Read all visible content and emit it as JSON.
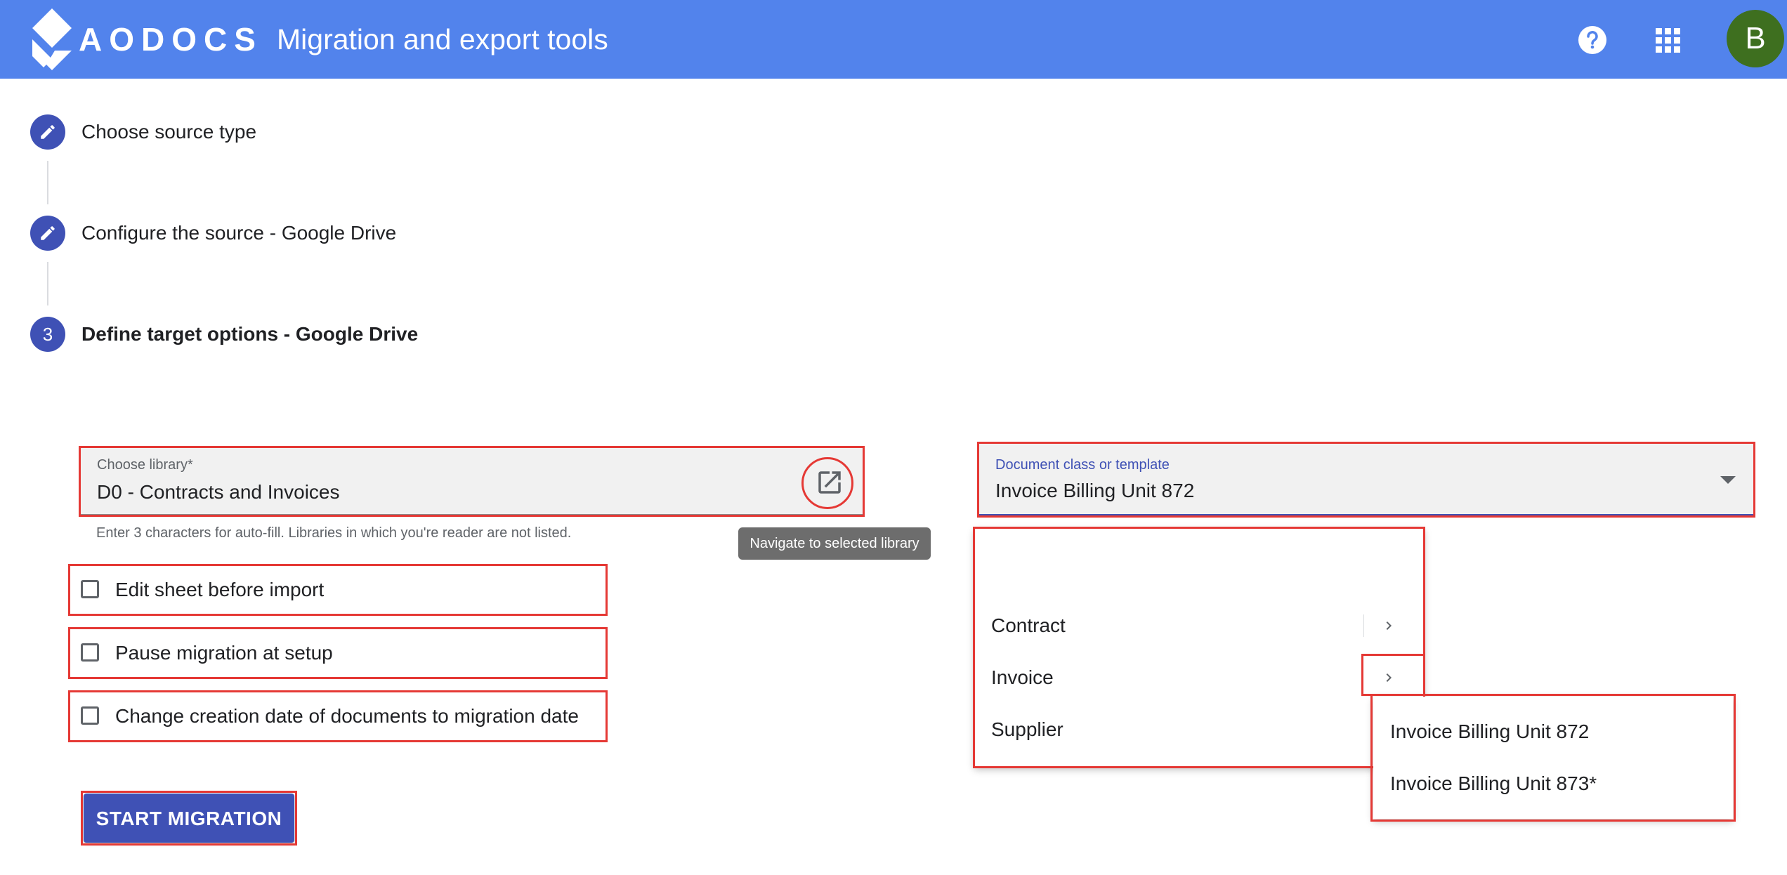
{
  "header": {
    "logo_text": "AODOCS",
    "title": "Migration and export tools",
    "help_icon": "help-icon",
    "apps_icon": "apps-grid-icon",
    "avatar_letter": "B",
    "color": "#5283ec"
  },
  "stepper": {
    "steps": [
      {
        "label": "Choose source type",
        "icon": "edit-icon"
      },
      {
        "label": "Configure the source - Google Drive",
        "icon": "edit-icon"
      },
      {
        "label": "Define target options - Google Drive",
        "number": "3"
      }
    ]
  },
  "library_field": {
    "label": "Choose library*",
    "value": "D0 - Contracts and Invoices",
    "hint": "Enter 3 characters for auto-fill. Libraries in which you're reader are not listed.",
    "tooltip": "Navigate to selected library",
    "icon": "open-in-new-icon"
  },
  "doc_class_field": {
    "label": "Document class or template",
    "value": "Invoice Billing Unit 872"
  },
  "options": [
    {
      "label": "Edit sheet before import",
      "checked": false
    },
    {
      "label": "Pause migration at setup",
      "checked": false
    },
    {
      "label": "Change creation date of documents to migration date",
      "checked": false
    }
  ],
  "start_button": "START MIGRATION",
  "class_menu": {
    "items": [
      "Contract",
      "Invoice",
      "Supplier"
    ]
  },
  "submenu": {
    "items": [
      "Invoice Billing Unit 872",
      "Invoice Billing Unit 873*"
    ]
  },
  "colors": {
    "primary": "#3f51b5",
    "highlight": "#e53935",
    "avatar": "#3e6f1f"
  }
}
